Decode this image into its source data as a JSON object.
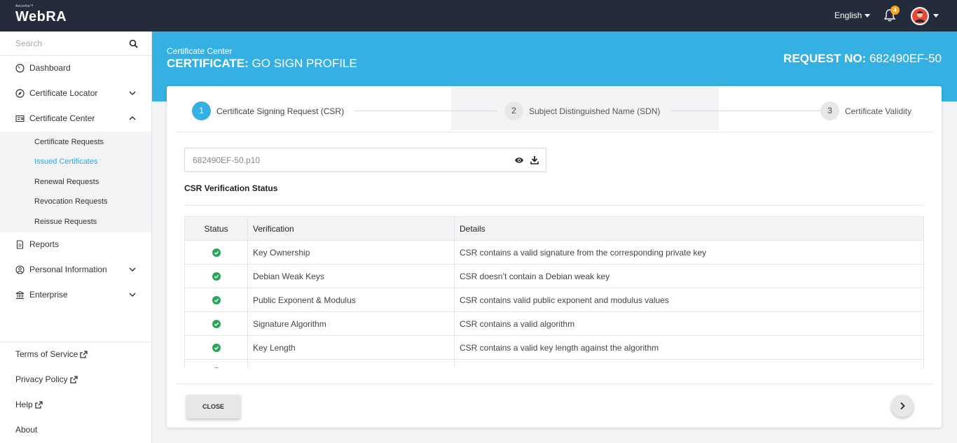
{
  "topbar": {
    "brand": "Ascertia™",
    "product": "WebRA",
    "language": "English",
    "notification_count": "4"
  },
  "sidebar": {
    "search_placeholder": "Search",
    "items": [
      {
        "label": "Dashboard",
        "icon": "dashboard-icon"
      },
      {
        "label": "Certificate Locator",
        "icon": "compass-icon"
      },
      {
        "label": "Certificate Center",
        "icon": "certificate-icon"
      },
      {
        "label": "Reports",
        "icon": "report-icon"
      },
      {
        "label": "Personal Information",
        "icon": "user-icon"
      },
      {
        "label": "Enterprise",
        "icon": "bank-icon"
      }
    ],
    "submenu": [
      {
        "label": "Certificate Requests"
      },
      {
        "label": "Issued Certificates"
      },
      {
        "label": "Renewal Requests"
      },
      {
        "label": "Revocation Requests"
      },
      {
        "label": "Reissue Requests"
      }
    ],
    "footer": [
      {
        "label": "Terms of Service"
      },
      {
        "label": "Privacy Policy"
      },
      {
        "label": "Help"
      },
      {
        "label": "About"
      }
    ]
  },
  "header": {
    "breadcrumb": "Certificate Center",
    "title_prefix": "CERTIFICATE:",
    "title": "GO SIGN PROFILE",
    "request_prefix": "REQUEST NO:",
    "request_no": "682490EF-50"
  },
  "steps": [
    {
      "num": "1",
      "label": "Certificate Signing Request (CSR)"
    },
    {
      "num": "2",
      "label": "Subject Distinguished Name (SDN)"
    },
    {
      "num": "3",
      "label": "Certificate Validity"
    }
  ],
  "file": {
    "name": "682490EF-50.p10"
  },
  "csr": {
    "heading": "CSR Verification Status",
    "columns": [
      "Status",
      "Verification",
      "Details"
    ],
    "rows": [
      {
        "verification": "Key Ownership",
        "details": "CSR contains a valid signature from the corresponding private key"
      },
      {
        "verification": "Debian Weak Keys",
        "details": "CSR doesn’t contain a Debian weak key"
      },
      {
        "verification": "Public Exponent & Modulus",
        "details": "CSR contains valid public exponent and modulus values"
      },
      {
        "verification": "Signature Algorithm",
        "details": "CSR contains a valid algorithm"
      },
      {
        "verification": "Key Length",
        "details": "CSR contains a valid key length against the algorithm"
      }
    ]
  },
  "actions": {
    "close_label": "CLOSE"
  },
  "colors": {
    "accent": "#35b0e2",
    "topbar": "#242b3a",
    "success": "#27a55a",
    "active_link": "#2fa6dc"
  }
}
